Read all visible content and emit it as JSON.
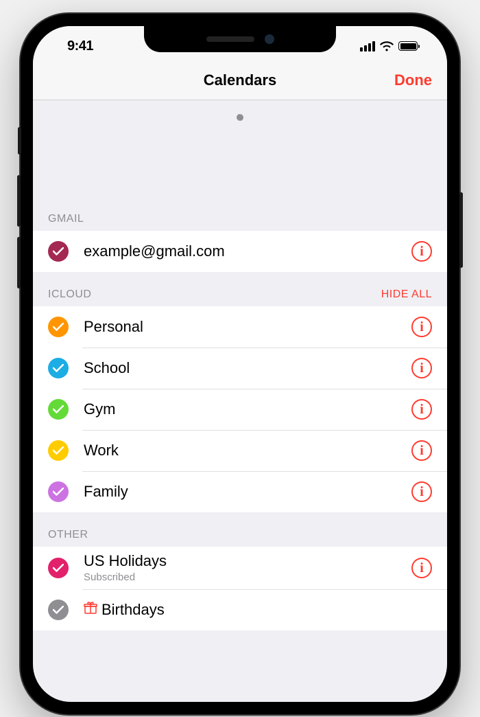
{
  "statusBar": {
    "time": "9:41"
  },
  "nav": {
    "title": "Calendars",
    "done": "Done"
  },
  "sections": [
    {
      "key": "gmail",
      "header": "GMAIL",
      "action": "",
      "items": [
        {
          "label": "example@gmail.com",
          "sublabel": "",
          "color": "#a32952",
          "checked": true,
          "info": true,
          "icon": ""
        }
      ]
    },
    {
      "key": "icloud",
      "header": "ICLOUD",
      "action": "HIDE ALL",
      "items": [
        {
          "label": "Personal",
          "sublabel": "",
          "color": "#ff9500",
          "checked": true,
          "info": true,
          "icon": ""
        },
        {
          "label": "School",
          "sublabel": "",
          "color": "#1cade4",
          "checked": true,
          "info": true,
          "icon": ""
        },
        {
          "label": "Gym",
          "sublabel": "",
          "color": "#63da38",
          "checked": true,
          "info": true,
          "icon": ""
        },
        {
          "label": "Work",
          "sublabel": "",
          "color": "#ffcc00",
          "checked": true,
          "info": true,
          "icon": ""
        },
        {
          "label": "Family",
          "sublabel": "",
          "color": "#cc73e1",
          "checked": true,
          "info": true,
          "icon": ""
        }
      ]
    },
    {
      "key": "other",
      "header": "OTHER",
      "action": "",
      "items": [
        {
          "label": "US Holidays",
          "sublabel": "Subscribed",
          "color": "#e2206b",
          "checked": true,
          "info": true,
          "icon": ""
        },
        {
          "label": "Birthdays",
          "sublabel": "",
          "color": "#8e8e93",
          "checked": true,
          "info": false,
          "icon": "gift"
        }
      ]
    }
  ]
}
